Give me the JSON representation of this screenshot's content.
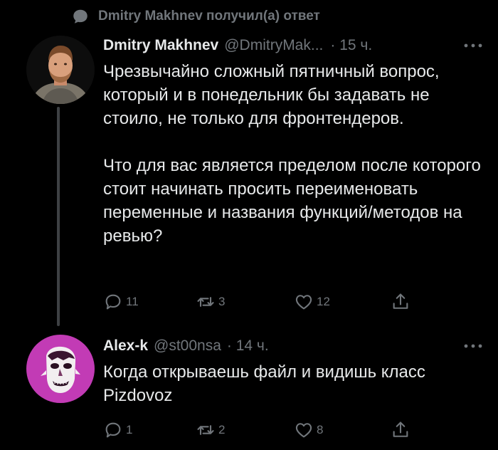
{
  "context": {
    "text": "Dmitry Makhnev получил(а) ответ",
    "icon": "reply-bubble-icon"
  },
  "tweets": [
    {
      "name": "Dmitry Makhnev",
      "handle": "@DmitryMak...",
      "time": "· 15 ч.",
      "paragraphs": [
        "Чрезвычайно сложный пятничный вопрос, который и в понедельник бы задавать не стоило, не только для фронтендеров.",
        "Что для вас является пределом после которого стоит начинать просить переименовать переменные и названия функций/методов на ревью?"
      ],
      "replies": "11",
      "retweets": "3",
      "likes": "12"
    },
    {
      "name": "Alex-k",
      "handle": "@st00nsa",
      "time": "· 14 ч.",
      "paragraphs": [
        "Когда открываешь файл и видишь класс Pizdovoz"
      ],
      "replies": "1",
      "retweets": "2",
      "likes": "8"
    }
  ],
  "colors": {
    "background": "#000000",
    "text": "#e7e9ea",
    "secondary": "#71767b",
    "thread_line": "#3e4144",
    "avatar2_bg": "#c23bb5"
  },
  "icons": [
    "reply-bubble-icon",
    "more-icon",
    "reply-icon",
    "retweet-icon",
    "like-icon",
    "share-icon"
  ]
}
